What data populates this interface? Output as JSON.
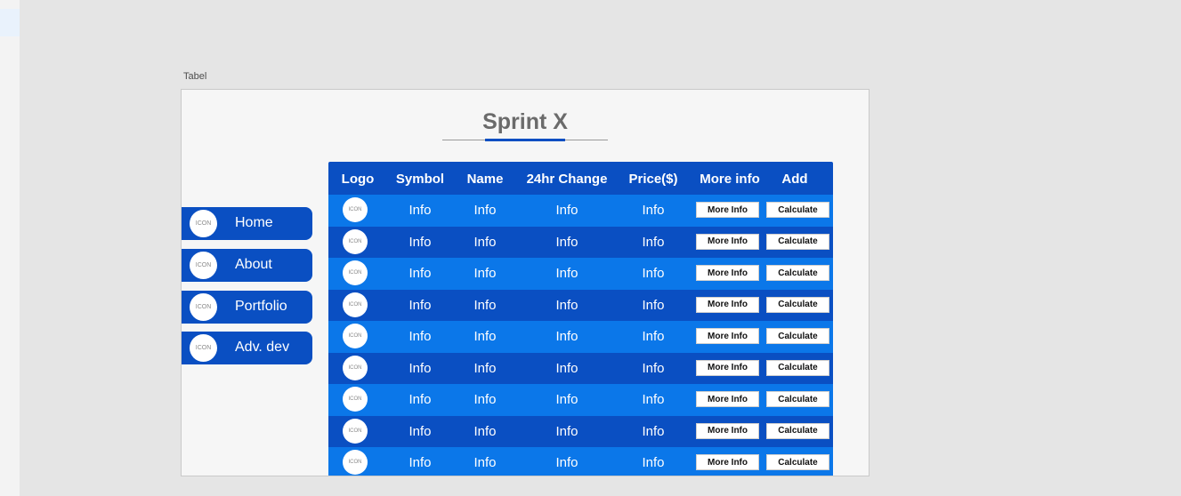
{
  "frame": {
    "label": "Tabel"
  },
  "page": {
    "title": "Sprint X"
  },
  "colors": {
    "primary": "#0a4fc2",
    "row_light": "#0b77e9",
    "canvas": "#e5e5e5"
  },
  "nav": [
    {
      "icon": "ICON",
      "label": "Home"
    },
    {
      "icon": "ICON",
      "label": "About"
    },
    {
      "icon": "ICON",
      "label": "Portfolio"
    },
    {
      "icon": "ICON",
      "label": "Adv. dev"
    }
  ],
  "table": {
    "headers": [
      "Logo",
      "Symbol",
      "Name",
      "24hr Change",
      "Price($)",
      "More info",
      "Add"
    ],
    "rows": [
      {
        "logo": "ICON",
        "symbol": "Info",
        "name": "Info",
        "change": "Info",
        "price": "Info",
        "more": "More Info",
        "add": "Calculate"
      },
      {
        "logo": "ICON",
        "symbol": "Info",
        "name": "Info",
        "change": "Info",
        "price": "Info",
        "more": "More Info",
        "add": "Calculate"
      },
      {
        "logo": "ICON",
        "symbol": "Info",
        "name": "Info",
        "change": "Info",
        "price": "Info",
        "more": "More Info",
        "add": "Calculate"
      },
      {
        "logo": "ICON",
        "symbol": "Info",
        "name": "Info",
        "change": "Info",
        "price": "Info",
        "more": "More Info",
        "add": "Calculate"
      },
      {
        "logo": "ICON",
        "symbol": "Info",
        "name": "Info",
        "change": "Info",
        "price": "Info",
        "more": "More Info",
        "add": "Calculate"
      },
      {
        "logo": "ICON",
        "symbol": "Info",
        "name": "Info",
        "change": "Info",
        "price": "Info",
        "more": "More Info",
        "add": "Calculate"
      },
      {
        "logo": "ICON",
        "symbol": "Info",
        "name": "Info",
        "change": "Info",
        "price": "Info",
        "more": "More Info",
        "add": "Calculate"
      },
      {
        "logo": "ICON",
        "symbol": "Info",
        "name": "Info",
        "change": "Info",
        "price": "Info",
        "more": "More Info",
        "add": "Calculate"
      },
      {
        "logo": "ICON",
        "symbol": "Info",
        "name": "Info",
        "change": "Info",
        "price": "Info",
        "more": "More Info",
        "add": "Calculate"
      }
    ]
  }
}
